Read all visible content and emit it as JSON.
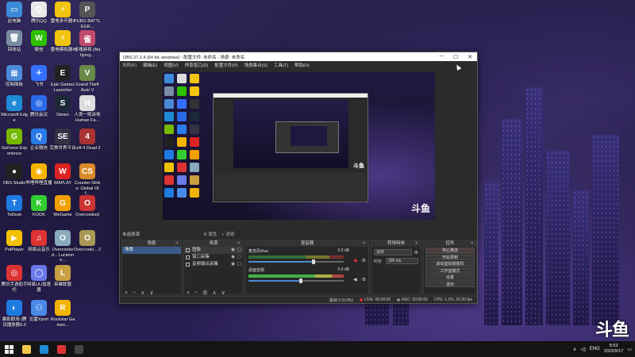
{
  "desktop": {
    "icons": [
      {
        "label": "此电脑",
        "color": "#3d8bd8",
        "glyph": "▭",
        "icon": "computer-icon"
      },
      {
        "label": "腾讯QQ",
        "color": "#e8e8e8",
        "glyph": "Q",
        "icon": "qq-icon"
      },
      {
        "label": "雷电多开器4",
        "color": "#f1c40f",
        "glyph": "⚡",
        "icon": "ldplayer-multi-icon"
      },
      {
        "label": "PUBG BATTLEGR...",
        "color": "#555",
        "glyph": "P",
        "icon": "pubg-icon"
      },
      {
        "label": "回收站",
        "color": "#7a8ea3",
        "glyph": "🗑",
        "icon": "recycle-bin-icon"
      },
      {
        "label": "微信",
        "color": "#2dc100",
        "glyph": "W",
        "icon": "wechat-icon"
      },
      {
        "label": "雷电模拟器4",
        "color": "#f1c40f",
        "glyph": "⚡",
        "icon": "ldplayer-icon"
      },
      {
        "label": "雀魂麻将 (Mahjong...",
        "color": "#c04a6a",
        "glyph": "雀",
        "icon": "mahjong-icon"
      },
      {
        "label": "控制面板",
        "color": "#4b8ad8",
        "glyph": "▦",
        "icon": "control-panel-icon"
      },
      {
        "label": "飞书",
        "color": "#3370ff",
        "glyph": "✈",
        "icon": "feishu-icon"
      },
      {
        "label": "Epic Games Launcher",
        "color": "#222",
        "glyph": "E",
        "icon": "epic-games-icon"
      },
      {
        "label": "Grand Theft Auto V",
        "color": "#6a8a4a",
        "glyph": "V",
        "icon": "gta-icon"
      },
      {
        "label": "Microsoft Edge",
        "color": "#1e8bd6",
        "glyph": "e",
        "icon": "edge-icon"
      },
      {
        "label": "腾讯会议",
        "color": "#2a6ae8",
        "glyph": "◎",
        "icon": "tencent-meeting-icon"
      },
      {
        "label": "Steam",
        "color": "#1b2838",
        "glyph": "S",
        "icon": "steam-icon"
      },
      {
        "label": "人类一败涂地 Human Fa...",
        "color": "#ddd",
        "glyph": "H",
        "icon": "human-fall-flat-icon"
      },
      {
        "label": "GeForce Experience",
        "color": "#76b900",
        "glyph": "G",
        "icon": "geforce-icon"
      },
      {
        "label": "企业微信",
        "color": "#2a7ae8",
        "glyph": "Q",
        "icon": "wecom-icon"
      },
      {
        "label": "完美世界平台",
        "color": "#334",
        "glyph": "SE",
        "icon": "perfect-world-icon"
      },
      {
        "label": "Left 4 Dead 2",
        "color": "#a33",
        "glyph": "4",
        "icon": "l4d2-icon"
      },
      {
        "label": "OBS Studio",
        "color": "#222",
        "glyph": "●",
        "icon": "obs-icon"
      },
      {
        "label": "哔哩哔哩直播",
        "color": "#f5b400",
        "glyph": "◉",
        "icon": "bilibili-live-icon"
      },
      {
        "label": "WAPLAY",
        "color": "#d22",
        "glyph": "W",
        "icon": "waplay-icon"
      },
      {
        "label": "Counter-Strike: Global Off...",
        "color": "#d98a2a",
        "glyph": "CS",
        "icon": "csgo-icon"
      },
      {
        "label": "ToDesk",
        "color": "#1e7be0",
        "glyph": "T",
        "icon": "todesk-icon"
      },
      {
        "label": "KOOK",
        "color": "#3c3",
        "glyph": "K",
        "icon": "kook-icon"
      },
      {
        "label": "WeGame",
        "color": "#f0a000",
        "glyph": "G",
        "icon": "wegame-icon"
      },
      {
        "label": "Overcooked",
        "color": "#c33",
        "glyph": "O",
        "icon": "overcooked-icon"
      },
      {
        "label": "PotPlayer",
        "color": "#f2c100",
        "glyph": "▶",
        "icon": "potplayer-icon"
      },
      {
        "label": "网易云音乐",
        "color": "#d33",
        "glyph": "♫",
        "icon": "netease-music-icon"
      },
      {
        "label": "Overcooked... Lucienne...",
        "color": "#8ab",
        "glyph": "O",
        "icon": "overcooked2-icon"
      },
      {
        "label": "Overcooki... 2",
        "color": "#a95",
        "glyph": "O",
        "icon": "overcooked-2-icon"
      },
      {
        "label": "腾讯手游助手 代",
        "color": "#d33",
        "glyph": "◎",
        "icon": "tencent-mobile-icon"
      },
      {
        "label": "网易UU加速器",
        "color": "#6a7ae8",
        "glyph": "◯",
        "icon": "uu-booster-icon"
      },
      {
        "label": "英雄联盟",
        "color": "#c8a040",
        "glyph": "L",
        "icon": "lol-icon"
      },
      {
        "label": "",
        "color": "transparent",
        "glyph": "",
        "icon": "empty-slot"
      },
      {
        "label": "暴影剧场 (腾讯播放器5.0",
        "color": "#1e7be0",
        "glyph": "◐",
        "icon": "player-icon"
      },
      {
        "label": "迅雷Xport",
        "color": "#4a8ae8",
        "glyph": "⚇",
        "icon": "xunlei-icon"
      },
      {
        "label": "Rockstar Games...",
        "color": "#f2b400",
        "glyph": "R",
        "icon": "rockstar-icon"
      }
    ]
  },
  "obs": {
    "title": "OBS 27.2.4 (64 bit, windows) - 配置文件: 未命名 - 场景: 未命名",
    "menu": [
      "文件(F)",
      "编辑(E)",
      "视图(V)",
      "停靠窗口(D)",
      "配置文件(P)",
      "场景集合(S)",
      "工具(T)",
      "帮助(H)"
    ],
    "watermark": "斗鱼",
    "status_row": {
      "label": "未选择源",
      "properties": "⚙ 属性",
      "filters": "◐ 滤镜"
    },
    "docks": {
      "scenes": {
        "title": "场景",
        "items": [
          "场景"
        ]
      },
      "sources": {
        "title": "来源",
        "items": [
          "图像",
          "窗口采集",
          "音频输出采集"
        ]
      },
      "mixer": {
        "title": "混音器",
        "channels": [
          {
            "name": "麦克风/Aux",
            "db": "0.0 dB",
            "level": 0.68
          },
          {
            "name": "桌面音频",
            "db": "0.0 dB",
            "level": 0.55
          }
        ]
      },
      "transitions": {
        "title": "转场特效",
        "type": "淡出",
        "duration_label": "时长",
        "duration": "300 ms"
      },
      "controls": {
        "title": "控件",
        "buttons": [
          "停止推流",
          "开始录制",
          "启动虚拟摄像机",
          "工作室模式",
          "设置",
          "退出"
        ]
      }
    },
    "statusbar": {
      "dropped": "丢帧 0 (0.0%)",
      "live": "LIVE: 00:00:00",
      "rec": "REC: 00:00:00",
      "cpu": "CPU: 1.3%, 30.00 fps"
    }
  },
  "taskbar": {
    "apps": [
      {
        "icon": "file-explorer-icon",
        "color": "#f2c84b"
      },
      {
        "icon": "edge-icon",
        "color": "#1e8bd6"
      },
      {
        "icon": "netease-music-icon",
        "color": "#d33"
      },
      {
        "icon": "obs-icon",
        "color": "#444"
      }
    ],
    "tray": {
      "lang": "ENG",
      "time": "8:53",
      "date": "2022/9/17"
    }
  }
}
